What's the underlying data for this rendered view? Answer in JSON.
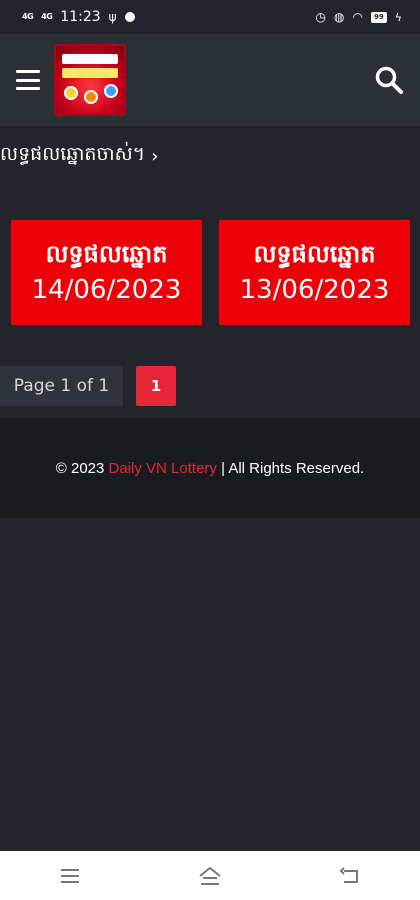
{
  "status_bar": {
    "signal_1": "4G",
    "signal_2": "4G",
    "time": "11:23",
    "battery": "99"
  },
  "header": {
    "menu_icon": "hamburger-menu-icon",
    "search_icon": "search-icon"
  },
  "breadcrumb": {
    "label": "លទ្ធផលឆ្នោតចាស់។",
    "chevron": "›"
  },
  "cards": [
    {
      "title": "លទ្ធផលឆ្នោត",
      "date": "14/06/2023"
    },
    {
      "title": "លទ្ធផលឆ្នោត",
      "date": "13/06/2023"
    }
  ],
  "pagination": {
    "info": "Page 1 of 1",
    "current": "1"
  },
  "footer": {
    "prefix": "© 2023 ",
    "brand": "Daily VN Lottery",
    "suffix": " | All Rights Reserved."
  },
  "colors": {
    "background": "#22252b",
    "header": "#2b2f36",
    "card_red": "#ed0007",
    "accent_red": "#e8263a",
    "footer": "#191b1f"
  }
}
